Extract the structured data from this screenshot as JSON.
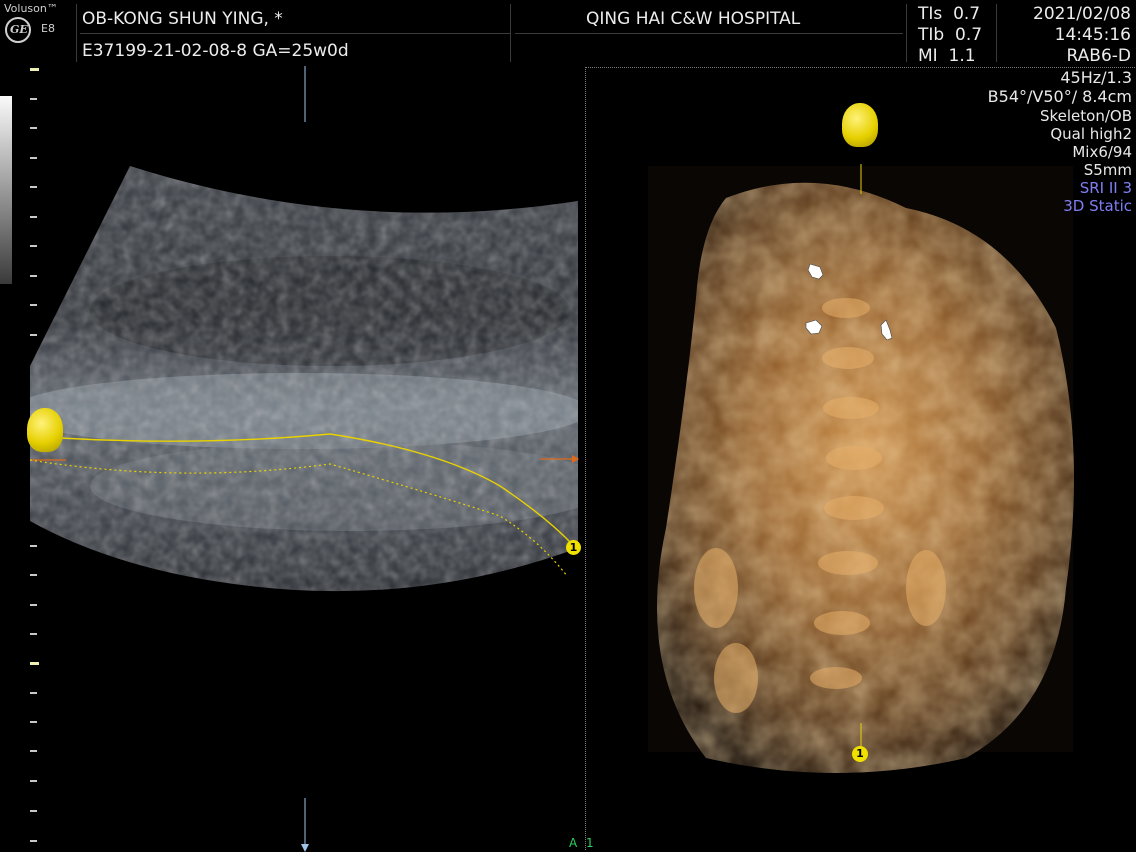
{
  "brand": {
    "name": "Voluson™",
    "model": "E8",
    "logo": "GE"
  },
  "patient": {
    "name_line": "OB-KONG SHUN YING,   *",
    "id_line": "E37199-21-02-08-8  GA=25w0d"
  },
  "hospital": "QING HAI C&W HOSPITAL",
  "indices": [
    {
      "label": "TIs",
      "value": "0.7"
    },
    {
      "label": "TIb",
      "value": "0.7"
    },
    {
      "label": "MI",
      "value": "1.1"
    }
  ],
  "datetime": {
    "date": "2021/02/08",
    "time": "14:45:16",
    "probe": "RAB6-D"
  },
  "settings": {
    "freq": "45Hz/1.3",
    "angles": "B54°/V50°/ 8.4cm",
    "preset": "Skeleton/OB",
    "quality": "Qual high2",
    "mix": "Mix6/94",
    "slice": "S5mm",
    "sri": "SRI II 3",
    "mode": "3D Static"
  },
  "markers": {
    "render_start": "1",
    "plane_label_a": "A",
    "plane_label_1": "1"
  },
  "colors": {
    "accent_yellow": "#f0e000",
    "mode_blue": "#7f7ff2",
    "arrow_orange": "#e06a1a",
    "render_amber": "#a8692c"
  }
}
